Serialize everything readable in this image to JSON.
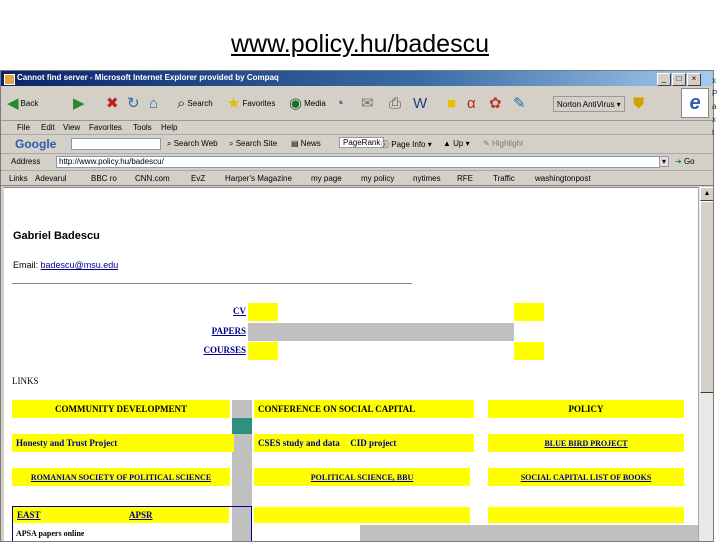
{
  "slide": {
    "title": "www.policy.hu/badescu"
  },
  "browser": {
    "title": "Cannot find server - Microsoft Internet Explorer provided by Compaq",
    "window_buttons": [
      "_",
      "□",
      "×"
    ],
    "toolbar": {
      "back": "Back",
      "search": "Search",
      "favorites": "Favorites",
      "media": "Media",
      "norton": "Norton AntiVirus"
    },
    "menu": [
      "File",
      "Edit",
      "View",
      "Favorites",
      "Tools",
      "Help"
    ],
    "google": {
      "label": "Google",
      "search_web": "Search Web",
      "search_site": "Search Site",
      "news": "News",
      "pagerank": "PageRank",
      "page_info": "Page Info",
      "up": "Up",
      "highlight": "Highlight"
    },
    "address": {
      "label": "Address",
      "value": "http://www.policy.hu/badescu/",
      "go": "Go"
    },
    "links": {
      "label": "Links",
      "items": [
        "Adevarul",
        "BBC ro",
        "CNN.com",
        "EvZ",
        "Harper's Magazine",
        "my page",
        "my policy",
        "nytimes",
        "RFE",
        "Traffic",
        "washingtonpost"
      ]
    },
    "right_fragment": [
      "x",
      "P",
      "a",
      "x",
      "t"
    ]
  },
  "page": {
    "name": "Gabriel Badescu",
    "email_label": "Email:",
    "email_value": "badescu@msu.edu",
    "nav": [
      "CV",
      "PAPERS",
      "COURSES"
    ],
    "links_heading": "LINKS",
    "links_row1": [
      "COMMUNITY DEVELOPMENT",
      "CONFERENCE ON SOCIAL CAPITAL",
      "POLICY"
    ],
    "links_row2": [
      "Honesty and Trust Project",
      "CSES study and data",
      "CID project",
      "BLUE BIRD PROJECT"
    ],
    "links_row3": [
      "ROMANIAN SOCIETY OF POLITICAL SCIENCE",
      "POLITICAL SCIENCE, BBU",
      "SOCIAL CAPITAL LIST OF BOOKS"
    ],
    "links_row4": [
      "EAST",
      "APSR"
    ],
    "links_row5": [
      "APSA papers online"
    ]
  },
  "colors": {
    "yellow": "#ffff00",
    "gray": "#c0c0c0",
    "teal": "#2f8f80",
    "link": "#00008b"
  }
}
